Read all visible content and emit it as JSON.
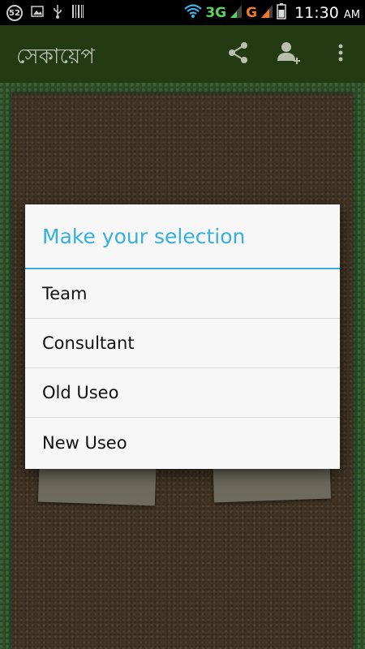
{
  "status_bar": {
    "notification_count": "52",
    "network_3g": "3G",
    "network_g": "G",
    "time": "11:30",
    "ampm": "AM"
  },
  "app_bar": {
    "title": "সেকায়েপ",
    "actions": [
      "share-icon",
      "add-person-icon",
      "overflow-menu-icon"
    ]
  },
  "dialog": {
    "title": "Make your selection",
    "options": [
      "Team",
      "Consultant",
      "Old Useo",
      "New Useo"
    ]
  },
  "colors": {
    "accent": "#36b0dc",
    "app_bar": "#233a13",
    "dialog_bg": "#f7f7f7"
  }
}
